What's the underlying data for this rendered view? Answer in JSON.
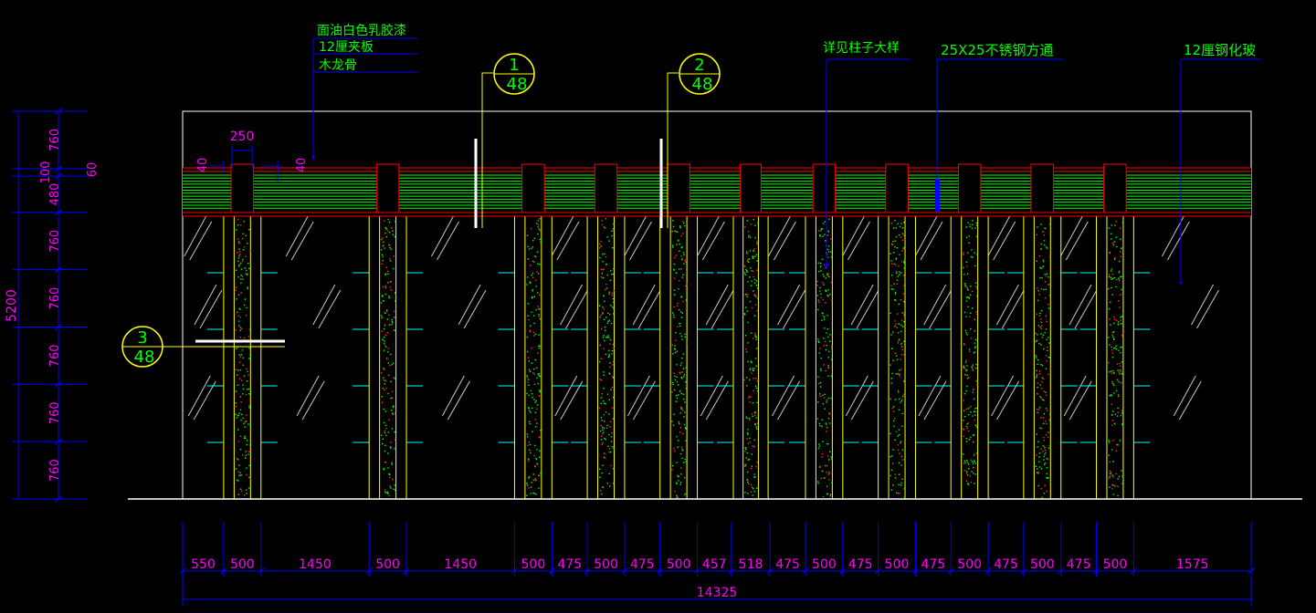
{
  "colors": {
    "background": "#000000",
    "frame": "#ffffff",
    "dimension": "#0000ff",
    "dimension_text": "#ff00ff",
    "label_text": "#00ff00",
    "leader": "#0000ff",
    "callout_circle": "#ffff00",
    "column": "#ffff00",
    "column_infill": "#00ff00",
    "wood_band": "#00ff00",
    "wood_border": "#ff0000",
    "mullion": "#00ffff",
    "glass_hatch": "#c8c8c8",
    "section_mark": "#ffffff"
  },
  "annotations": {
    "paint": "面油白色乳胶漆",
    "plywood": "12厘夹板",
    "wood_keel": "木龙骨",
    "column_detail": "详见柱子大样",
    "steel_tube": "25X25不锈钢方通",
    "tempered_glass": "12厘钢化玻"
  },
  "callouts": [
    {
      "number": "1",
      "sheet": "48"
    },
    {
      "number": "2",
      "sheet": "48"
    },
    {
      "number": "3",
      "sheet": "48"
    }
  ],
  "top_dims": {
    "col_width": "250",
    "gap_left": "40",
    "gap_right": "40"
  },
  "vertical_dims": {
    "total": "5200",
    "segments": [
      "760",
      "100",
      "480",
      "760",
      "760",
      "760",
      "760",
      "760"
    ],
    "band_top": "60"
  },
  "horizontal_dims": {
    "segments": [
      "550",
      "500",
      "1450",
      "500",
      "1450",
      "500",
      "475",
      "500",
      "475",
      "500",
      "457",
      "518",
      "475",
      "500",
      "475",
      "500",
      "475",
      "500",
      "475",
      "500",
      "475",
      "500",
      "1575"
    ],
    "total": "14325"
  }
}
